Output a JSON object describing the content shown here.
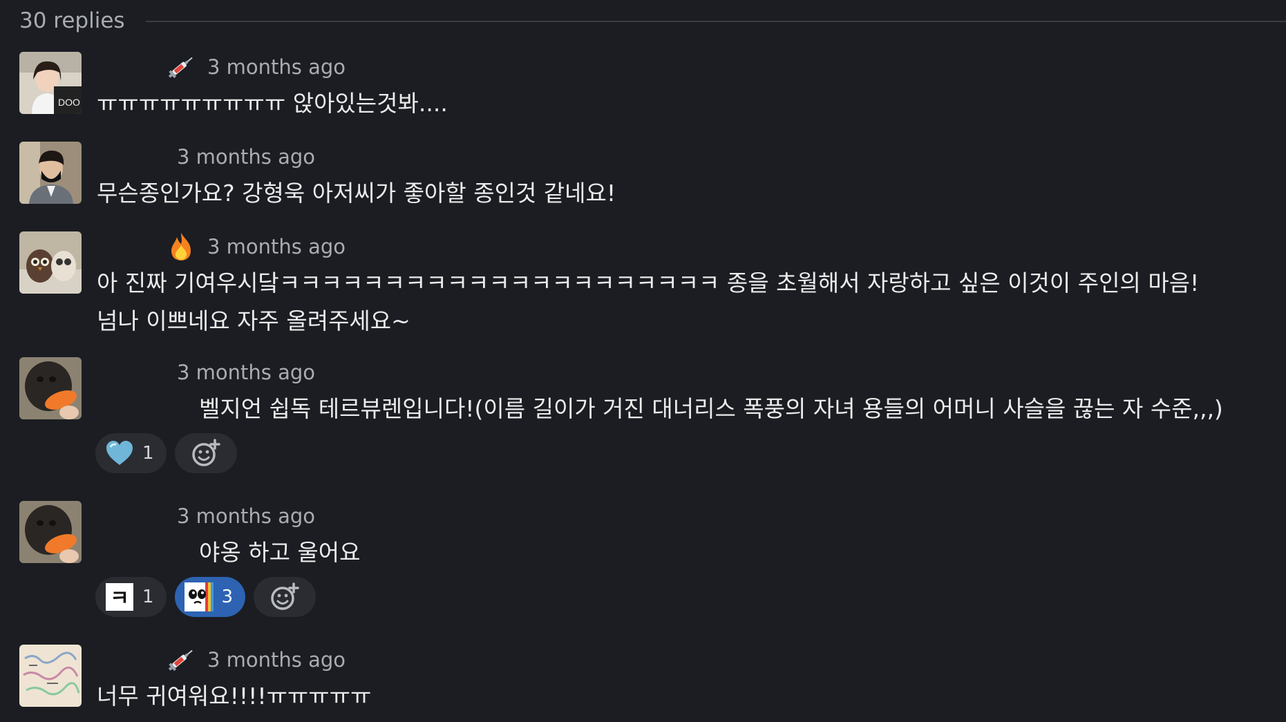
{
  "replies_header": {
    "count_label": "30 replies"
  },
  "colors": {
    "background": "#1b1d22",
    "meta_text": "#a9acb2",
    "message_text": "#ebebeb",
    "reaction_bg": "#2a2c31",
    "reaction_active_bg": "#2d63b2"
  },
  "replies": [
    {
      "author_name": "",
      "status_icon": "syringe-icon",
      "time": "3 months ago",
      "lines": [
        "ㅠㅠㅠㅠㅠㅠㅠㅠㅠ 앉아있는것봐...."
      ],
      "reactions": []
    },
    {
      "author_name": "",
      "status_icon": "",
      "time": "3 months ago",
      "lines": [
        "무슨종인가요? 강형욱 아저씨가 좋아할 종인것 같네요!"
      ],
      "reactions": []
    },
    {
      "author_name": "",
      "status_icon": "fire-icon",
      "time": "3 months ago",
      "lines": [
        "아 진짜 기여우시닼ㅋㅋㅋㅋㅋㅋㅋㅋㅋㅋㅋㅋㅋㅋㅋㅋㅋㅋㅋㅋㅋ 종을 초월해서 자랑하고 싶은 이것이 주인의 마음!",
        "넘나 이쁘네요 자주 올려주세요~"
      ],
      "reactions": []
    },
    {
      "author_name": "",
      "status_icon": "",
      "time": "3 months ago",
      "lines": [
        "벨지언 쉽독 테르뷰렌입니다!(이름 길이가 거진 대너리스 폭풍의 자녀 용들의 어머니 사슬을 끊는 자 수준,,,)"
      ],
      "reactions": [
        {
          "emoji": "blue-heart-icon",
          "count": "1",
          "active": false
        }
      ]
    },
    {
      "author_name": "",
      "status_icon": "",
      "time": "3 months ago",
      "lines": [
        "야옹 하고 울어요"
      ],
      "reactions": [
        {
          "emoji": "kieuk-icon",
          "label": "ㅋ",
          "count": "1",
          "active": false
        },
        {
          "emoji": "rainbow-face-icon",
          "count": "3",
          "active": true
        }
      ]
    },
    {
      "author_name": "",
      "status_icon": "syringe-icon",
      "time": "3 months ago",
      "lines": [
        "너무 귀여워요!!!!ㅠㅠㅠㅠㅠ"
      ],
      "reactions": []
    }
  ],
  "add_reaction_icon": "add-reaction-icon"
}
